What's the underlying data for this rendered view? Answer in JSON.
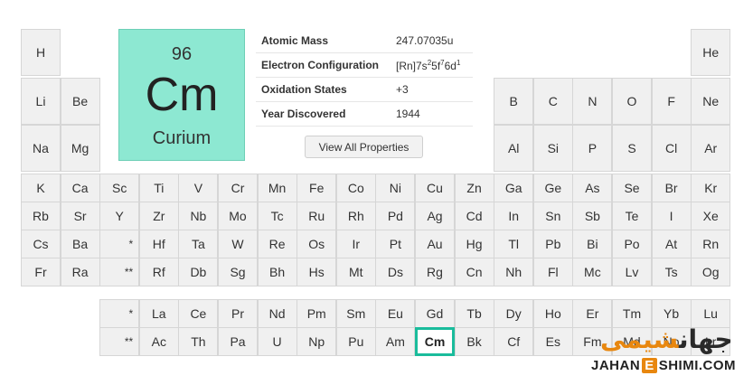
{
  "featured": {
    "number": "96",
    "symbol": "Cm",
    "name": "Curium",
    "color": "#8de8d2"
  },
  "properties": [
    {
      "label": "Atomic Mass",
      "value": "247.07035u"
    },
    {
      "label": "Electron Configuration",
      "value_parts": [
        "[Rn]7s",
        "2",
        "5f",
        "7",
        "6d",
        "1"
      ]
    },
    {
      "label": "Oxidation States",
      "value": "+3"
    },
    {
      "label": "Year Discovered",
      "value": "1944"
    }
  ],
  "view_button": "View All Properties",
  "selected_color": "#1abc9c",
  "table": {
    "row1": [
      "H",
      "He"
    ],
    "row2": [
      "Li",
      "Be",
      "B",
      "C",
      "N",
      "O",
      "F",
      "Ne"
    ],
    "row3": [
      "Na",
      "Mg",
      "Al",
      "Si",
      "P",
      "S",
      "Cl",
      "Ar"
    ],
    "row4": [
      "K",
      "Ca",
      "Sc",
      "Ti",
      "V",
      "Cr",
      "Mn",
      "Fe",
      "Co",
      "Ni",
      "Cu",
      "Zn",
      "Ga",
      "Ge",
      "As",
      "Se",
      "Br",
      "Kr"
    ],
    "row5": [
      "Rb",
      "Sr",
      "Y",
      "Zr",
      "Nb",
      "Mo",
      "Tc",
      "Ru",
      "Rh",
      "Pd",
      "Ag",
      "Cd",
      "In",
      "Sn",
      "Sb",
      "Te",
      "I",
      "Xe"
    ],
    "row6": [
      "Cs",
      "Ba",
      "*",
      "Hf",
      "Ta",
      "W",
      "Re",
      "Os",
      "Ir",
      "Pt",
      "Au",
      "Hg",
      "Tl",
      "Pb",
      "Bi",
      "Po",
      "At",
      "Rn"
    ],
    "row7": [
      "Fr",
      "Ra",
      "**",
      "Rf",
      "Db",
      "Sg",
      "Bh",
      "Hs",
      "Mt",
      "Ds",
      "Rg",
      "Cn",
      "Nh",
      "Fl",
      "Mc",
      "Lv",
      "Ts",
      "Og"
    ],
    "lanthanides": [
      "*",
      "La",
      "Ce",
      "Pr",
      "Nd",
      "Pm",
      "Sm",
      "Eu",
      "Gd",
      "Tb",
      "Dy",
      "Ho",
      "Er",
      "Tm",
      "Yb",
      "Lu"
    ],
    "actinides": [
      "**",
      "Ac",
      "Th",
      "Pa",
      "U",
      "Np",
      "Pu",
      "Am",
      "Cm",
      "Bk",
      "Cf",
      "Es",
      "Fm",
      "Md",
      "No",
      "Lr"
    ]
  },
  "selected_symbol": "Cm",
  "watermark": {
    "arabic_dark": "جهان",
    "arabic_accent": "شیمی",
    "latin_a": "JAHAN",
    "latin_e": "E",
    "latin_b": "SHIMI.COM",
    "accent_color": "#e8870f"
  }
}
